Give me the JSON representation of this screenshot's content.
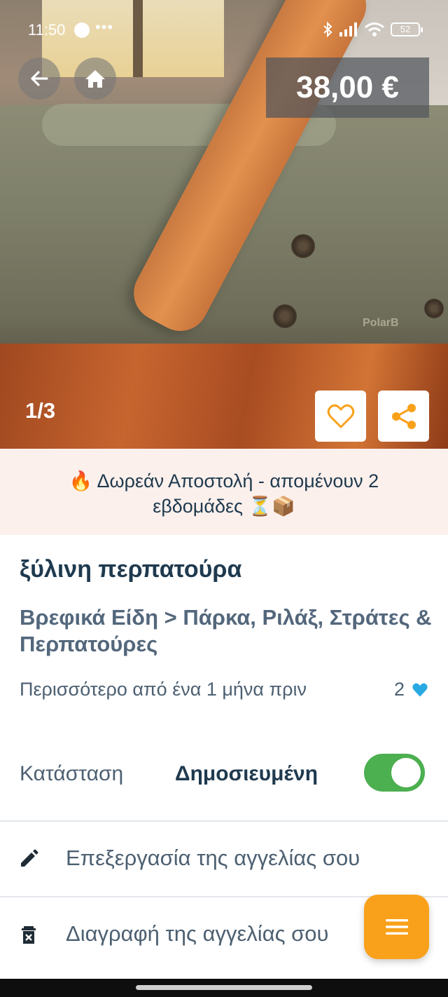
{
  "status_bar": {
    "time": "11:50",
    "more": "•••",
    "battery": "52"
  },
  "listing": {
    "price": "38,00 €",
    "image_counter": "1/3",
    "banner_line1": "🔥 Δωρεάν Αποστολή - απομένουν 2",
    "banner_line2": "εβδομάδες ⏳📦",
    "title": "ξύλινη περπατούρα",
    "category": "Βρεφικά Είδη > Πάρκα, Ριλάξ, Στράτες & Περπατούρες",
    "posted": "Περισσότερο από ένα 1 μήνα πριν",
    "likes": "2",
    "brand_text": "PolarB"
  },
  "state": {
    "label": "Κατάσταση",
    "value": "Δημοσιευμένη",
    "published": true
  },
  "actions": {
    "edit": "Επεξεργασία της αγγελίας σου",
    "delete": "Διαγραφή της αγγελίας σου"
  },
  "colors": {
    "accent_orange": "#f9a11b",
    "toggle_green": "#4caf50",
    "heart_blue": "#29a9e1",
    "text_dark": "#1f3a4f"
  }
}
